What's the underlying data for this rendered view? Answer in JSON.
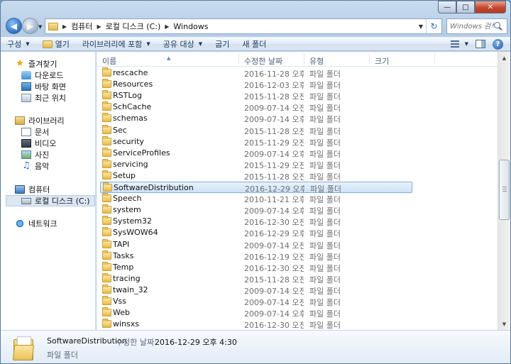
{
  "window": {
    "controls": {
      "minimize": "—",
      "maximize": "□",
      "close": "✕"
    }
  },
  "nav": {
    "back_glyph": "◀",
    "forward_glyph": "▶",
    "breadcrumb": [
      "컴퓨터",
      "로컬 디스크 (C:)",
      "Windows"
    ],
    "refresh_glyph": "↻",
    "search_placeholder": "Windows 검색"
  },
  "toolbar": {
    "organize": "구성",
    "open": "열기",
    "include_library": "라이브러리에 포함",
    "share_with": "공유 대상",
    "burn": "굽기",
    "new_folder": "새 폴더",
    "help": "?"
  },
  "sidebar": {
    "favorites": "즐겨찾기",
    "downloads": "다운로드",
    "desktop": "바탕 화면",
    "recent": "최근 위치",
    "libraries": "라이브러리",
    "documents": "문서",
    "videos": "비디오",
    "pictures": "사진",
    "music": "음악",
    "computer": "컴퓨터",
    "local_disk": "로컬 디스크 (C:)",
    "network": "네트워크"
  },
  "columns": {
    "name": "이름",
    "modified": "수정한 날짜",
    "type": "유형",
    "size": "크기"
  },
  "files": [
    {
      "name": "rescache",
      "date": "2016-11-28 오후 ...",
      "type": "파일 폴더"
    },
    {
      "name": "Resources",
      "date": "2016-12-03 오후 ...",
      "type": "파일 폴더"
    },
    {
      "name": "RSTLog",
      "date": "2015-11-28 오전 ...",
      "type": "파일 폴더"
    },
    {
      "name": "SchCache",
      "date": "2009-07-14 오전 ...",
      "type": "파일 폴더"
    },
    {
      "name": "schemas",
      "date": "2009-07-14 오후 ...",
      "type": "파일 폴더"
    },
    {
      "name": "Sec",
      "date": "2015-11-28 오전 ...",
      "type": "파일 폴더"
    },
    {
      "name": "security",
      "date": "2015-11-29 오전 ...",
      "type": "파일 폴더"
    },
    {
      "name": "ServiceProfiles",
      "date": "2009-07-14 오후 ...",
      "type": "파일 폴더"
    },
    {
      "name": "servicing",
      "date": "2015-11-29 오전 ...",
      "type": "파일 폴더"
    },
    {
      "name": "Setup",
      "date": "2015-11-28 오전 ...",
      "type": "파일 폴더"
    },
    {
      "name": "SoftwareDistribution",
      "date": "2016-12-29 오후 ...",
      "type": "파일 폴더",
      "selected": true
    },
    {
      "name": "Speech",
      "date": "2010-11-21 오후 ...",
      "type": "파일 폴더"
    },
    {
      "name": "system",
      "date": "2009-07-14 오후 ...",
      "type": "파일 폴더"
    },
    {
      "name": "System32",
      "date": "2016-12-30 오전 ...",
      "type": "파일 폴더"
    },
    {
      "name": "SysWOW64",
      "date": "2016-12-29 오후 ...",
      "type": "파일 폴더"
    },
    {
      "name": "TAPI",
      "date": "2009-07-14 오전 ...",
      "type": "파일 폴더"
    },
    {
      "name": "Tasks",
      "date": "2016-12-19 오전 ...",
      "type": "파일 폴더"
    },
    {
      "name": "Temp",
      "date": "2016-12-30 오전 ...",
      "type": "파일 폴더"
    },
    {
      "name": "tracing",
      "date": "2015-11-28 오전 ...",
      "type": "파일 폴더"
    },
    {
      "name": "twain_32",
      "date": "2009-07-14 오전 ...",
      "type": "파일 폴더"
    },
    {
      "name": "Vss",
      "date": "2009-07-14 오전 ...",
      "type": "파일 폴더"
    },
    {
      "name": "Web",
      "date": "2009-07-14 오후 ...",
      "type": "파일 폴더"
    },
    {
      "name": "winsxs",
      "date": "2016-12-30 오전 ...",
      "type": "파일 폴더"
    }
  ],
  "details": {
    "name": "SoftwareDistribution",
    "modified_label": "수정한 날짜:",
    "modified_value": "2016-12-29 오후 4:30",
    "type": "파일 폴더"
  }
}
